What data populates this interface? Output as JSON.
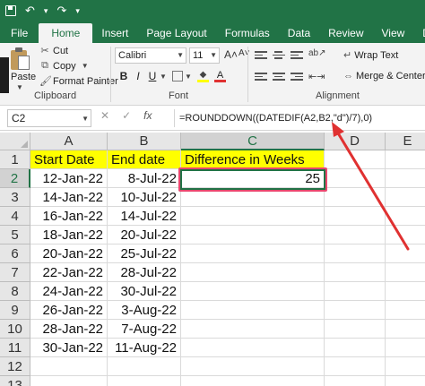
{
  "quick_access": {
    "save_icon": "save-icon",
    "undo_glyph": "↶",
    "redo_glyph": "↷",
    "customize_glyph": "⏷"
  },
  "tabs": [
    "File",
    "Home",
    "Insert",
    "Page Layout",
    "Formulas",
    "Data",
    "Review",
    "View",
    "Developer"
  ],
  "ribbon": {
    "clipboard": {
      "paste_label": "Paste",
      "cut_label": "Cut",
      "copy_label": "Copy",
      "format_painter_label": "Format Painter",
      "group_label": "Clipboard"
    },
    "font": {
      "font_name": "Calibri",
      "font_size": "11",
      "group_label": "Font",
      "bold": "B",
      "italic": "I",
      "underline": "U",
      "grow": "A˄",
      "shrink": "A˅"
    },
    "alignment": {
      "wrap_text_label": "Wrap Text",
      "merge_center_label": "Merge & Center",
      "group_label": "Alignment",
      "orientation_glyph": "ab↗"
    }
  },
  "formula_bar": {
    "name_box": "C2",
    "cancel_glyph": "✕",
    "enter_glyph": "✓",
    "fx_glyph": "fx",
    "formula": "=ROUNDDOWN((DATEDIF(A2,B2,\"d\")/7),0)"
  },
  "grid": {
    "columns": [
      "A",
      "B",
      "C",
      "D",
      "E"
    ],
    "selected_column": "C",
    "selected_row": "2",
    "rows": [
      {
        "num": "1",
        "a": "Start Date",
        "b": "End date",
        "c": "Difference in Weeks"
      },
      {
        "num": "2",
        "a": "12-Jan-22",
        "b": "8-Jul-22",
        "c": "25"
      },
      {
        "num": "3",
        "a": "14-Jan-22",
        "b": "10-Jul-22",
        "c": ""
      },
      {
        "num": "4",
        "a": "16-Jan-22",
        "b": "14-Jul-22",
        "c": ""
      },
      {
        "num": "5",
        "a": "18-Jan-22",
        "b": "20-Jul-22",
        "c": ""
      },
      {
        "num": "6",
        "a": "20-Jan-22",
        "b": "25-Jul-22",
        "c": ""
      },
      {
        "num": "7",
        "a": "22-Jan-22",
        "b": "28-Jul-22",
        "c": ""
      },
      {
        "num": "8",
        "a": "24-Jan-22",
        "b": "30-Jul-22",
        "c": ""
      },
      {
        "num": "9",
        "a": "26-Jan-22",
        "b": "3-Aug-22",
        "c": ""
      },
      {
        "num": "10",
        "a": "28-Jan-22",
        "b": "7-Aug-22",
        "c": ""
      },
      {
        "num": "11",
        "a": "30-Jan-22",
        "b": "11-Aug-22",
        "c": ""
      },
      {
        "num": "12",
        "a": "",
        "b": "",
        "c": ""
      },
      {
        "num": "13",
        "a": "",
        "b": "",
        "c": ""
      }
    ]
  },
  "colors": {
    "excel_green": "#217346",
    "header_fill": "#ffff00",
    "highlight_border": "#e8476e",
    "annotation_arrow": "#e03131"
  },
  "annotation": {
    "type": "arrow",
    "from": "cell-C2",
    "to": "formula-bar"
  }
}
